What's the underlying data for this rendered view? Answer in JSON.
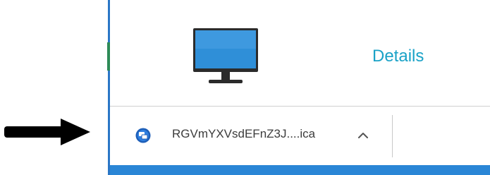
{
  "details": {
    "label": "Details"
  },
  "download": {
    "file_name": "RGVmYXVsdEFnZ3J....ica",
    "file_icon": "citrix-receiver-icon",
    "chevron_icon": "chevron-up-icon"
  },
  "icons": {
    "monitor": "desktop-monitor-icon",
    "pointer": "arrow-right-icon"
  },
  "colors": {
    "accent": "#1aa2c7",
    "monitor_screen": "#2f8fd8",
    "monitor_frame": "#2b2b2b",
    "taskbar": "#2a86d6",
    "arrow": "#000000"
  }
}
